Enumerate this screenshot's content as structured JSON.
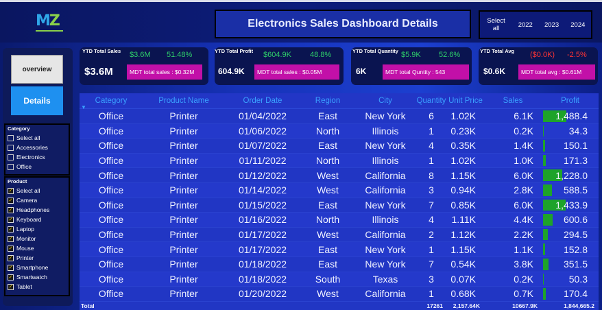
{
  "header": {
    "logo_text": "MZ",
    "title": "Electronics Sales Dashboard Details",
    "years": [
      "Select all",
      "2022",
      "2023",
      "2024"
    ]
  },
  "nav": {
    "overview": "overview",
    "details": "Details"
  },
  "category_slicer": {
    "title": "Category",
    "items": [
      {
        "label": "Select all",
        "checked": false
      },
      {
        "label": "Accessories",
        "checked": false
      },
      {
        "label": "Electronics",
        "checked": false
      },
      {
        "label": "Office",
        "checked": false
      }
    ]
  },
  "product_slicer": {
    "title": "Product",
    "items": [
      {
        "label": "Select all",
        "checked": true
      },
      {
        "label": "Camera",
        "checked": true
      },
      {
        "label": "Headphones",
        "checked": true
      },
      {
        "label": "Keyboard",
        "checked": true
      },
      {
        "label": "Laptop",
        "checked": true
      },
      {
        "label": "Monitor",
        "checked": true
      },
      {
        "label": "Mouse",
        "checked": true
      },
      {
        "label": "Printer",
        "checked": true
      },
      {
        "label": "Smartphone",
        "checked": true
      },
      {
        "label": "Smartwatch",
        "checked": true
      },
      {
        "label": "Tablet",
        "checked": true
      }
    ]
  },
  "kpis": {
    "sales": {
      "label": "YTD Total Sales",
      "value1": "$3.6M",
      "value2": "51.48%",
      "big": "$3.6M",
      "mdt": "MDT total sales : $0.32M"
    },
    "profit": {
      "label": "YTD Total Profit",
      "value1": "$604.9K",
      "value2": "48.8%",
      "big": "604.9K",
      "mdt": "MDT total sales : $0.05M"
    },
    "quantity": {
      "label": "YTD Total Quantity",
      "value1": "$5.9K",
      "value2": "52.6%",
      "big": "6K",
      "mdt": "MDT total Quntity : 543"
    },
    "avg": {
      "label": "YTD Total Avg",
      "value1": "($0.0K)",
      "value2": "-2.5%",
      "big": "$0.6K",
      "mdt": "MDT total avg : $0.61M"
    }
  },
  "colors": {
    "positive": "#2fd06a",
    "negative": "#ff3333",
    "mdt_bg": "#c210a8",
    "profit_bar": "#1ea32a"
  },
  "table": {
    "columns": [
      "Category",
      "Product Name",
      "Order Date",
      "Region",
      "City",
      "Quantity",
      "Unit Price",
      "Sales",
      "Profit"
    ],
    "rows": [
      [
        "Office",
        "Printer",
        "01/04/2022",
        "East",
        "New York",
        "6",
        "1.02K",
        "6.1K",
        "1,488.4"
      ],
      [
        "Office",
        "Printer",
        "01/06/2022",
        "North",
        "Illinois",
        "1",
        "0.23K",
        "0.2K",
        "34.3"
      ],
      [
        "Office",
        "Printer",
        "01/07/2022",
        "East",
        "New York",
        "4",
        "0.35K",
        "1.4K",
        "150.1"
      ],
      [
        "Office",
        "Printer",
        "01/11/2022",
        "North",
        "Illinois",
        "1",
        "1.02K",
        "1.0K",
        "171.3"
      ],
      [
        "Office",
        "Printer",
        "01/12/2022",
        "West",
        "California",
        "8",
        "1.15K",
        "6.0K",
        "1,228.0"
      ],
      [
        "Office",
        "Printer",
        "01/14/2022",
        "West",
        "California",
        "3",
        "0.94K",
        "2.8K",
        "588.5"
      ],
      [
        "Office",
        "Printer",
        "01/15/2022",
        "East",
        "New York",
        "7",
        "0.85K",
        "6.0K",
        "1,433.9"
      ],
      [
        "Office",
        "Printer",
        "01/16/2022",
        "North",
        "Illinois",
        "4",
        "1.11K",
        "4.4K",
        "600.6"
      ],
      [
        "Office",
        "Printer",
        "01/17/2022",
        "West",
        "California",
        "2",
        "1.12K",
        "2.2K",
        "294.5"
      ],
      [
        "Office",
        "Printer",
        "01/17/2022",
        "East",
        "New York",
        "1",
        "1.15K",
        "1.1K",
        "152.8"
      ],
      [
        "Office",
        "Printer",
        "01/18/2022",
        "East",
        "New York",
        "7",
        "0.54K",
        "3.8K",
        "351.5"
      ],
      [
        "Office",
        "Printer",
        "01/18/2022",
        "South",
        "Texas",
        "3",
        "0.07K",
        "0.2K",
        "50.3"
      ],
      [
        "Office",
        "Printer",
        "01/20/2022",
        "West",
        "California",
        "1",
        "0.68K",
        "0.7K",
        "170.4"
      ]
    ],
    "profit_values": [
      1488.4,
      34.3,
      150.1,
      171.3,
      1228.0,
      588.5,
      1433.9,
      600.6,
      294.5,
      152.8,
      351.5,
      50.3,
      170.4
    ],
    "total": {
      "label": "Total",
      "quantity": "17261",
      "unit_price": "2,157.64K",
      "sales": "10667.9K",
      "profit": "1,844,665.2"
    }
  }
}
